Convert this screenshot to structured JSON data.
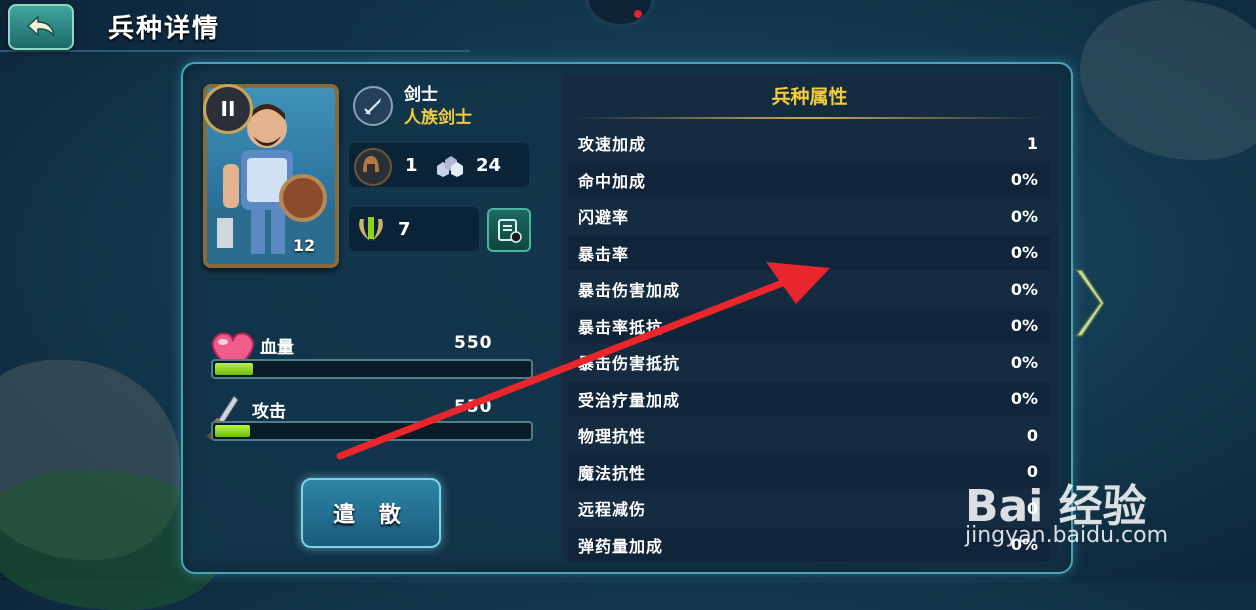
{
  "header": {
    "title": "兵种详情",
    "back_icon": "back-arrow-icon"
  },
  "unit": {
    "rank": "II",
    "card_level": "12",
    "class_icon": "sword-icon",
    "name": "剑士",
    "race": "人族剑士",
    "helmet_count": "1",
    "troop_count": "24",
    "power_count": "7"
  },
  "bars": {
    "hp": {
      "label": "血量",
      "value": "550",
      "fill": 0.12
    },
    "attack": {
      "label": "攻击",
      "value": "550",
      "fill": 0.11
    }
  },
  "disband_label": "遣 散",
  "attributes": {
    "title": "兵种属性",
    "rows": [
      {
        "name": "攻速加成",
        "value": "1"
      },
      {
        "name": "命中加成",
        "value": "0%"
      },
      {
        "name": "闪避率",
        "value": "0%"
      },
      {
        "name": "暴击率",
        "value": "0%"
      },
      {
        "name": "暴击伤害加成",
        "value": "0%"
      },
      {
        "name": "暴击率抵抗",
        "value": "0%"
      },
      {
        "name": "暴击伤害抵抗",
        "value": "0%"
      },
      {
        "name": "受治疗量加成",
        "value": "0%"
      },
      {
        "name": "物理抗性",
        "value": "0"
      },
      {
        "name": "魔法抗性",
        "value": "0"
      },
      {
        "name": "远程减伤",
        "value": "0"
      },
      {
        "name": "弹药量加成",
        "value": "0%"
      }
    ]
  },
  "watermark": {
    "main": "Bai 经验",
    "sub": "jingyan.baidu.com"
  },
  "colors": {
    "gold": "#f4cc3a",
    "panel_border": "#4aa2b5",
    "bar_fill": "#8fd21a",
    "arrow": "#e8262b"
  }
}
